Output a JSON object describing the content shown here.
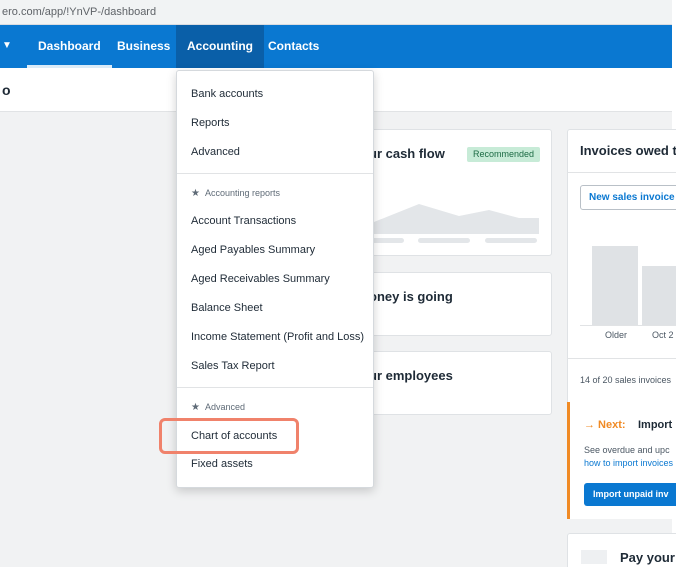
{
  "browser": {
    "url": "ero.com/app/!YnVP-/dashboard"
  },
  "nav": {
    "items": [
      {
        "label": "Dashboard"
      },
      {
        "label": "Business"
      },
      {
        "label": "Accounting"
      },
      {
        "label": "Contacts"
      }
    ],
    "active": "Accounting"
  },
  "org": {
    "name_fragment": "o"
  },
  "cards": {
    "cash_flow": {
      "title": "ur cash flow",
      "badge": "Recommended"
    },
    "money": {
      "title": "oney is going"
    },
    "employees": {
      "title": "ur employees"
    }
  },
  "invoices": {
    "title": "Invoices owed t",
    "new_button": "New sales invoice",
    "chart_labels": [
      "Older",
      "Oct 2"
    ],
    "summary": "14 of 20 sales invoices",
    "next": {
      "label": "→  Next:",
      "title": "Import",
      "description": "See overdue and upc",
      "link": "how to import invoices",
      "button": "Import unpaid inv"
    }
  },
  "pay_card": {
    "title": "Pay your"
  },
  "menu": {
    "top_items": [
      "Bank accounts",
      "Reports",
      "Advanced"
    ],
    "reports_header": "Accounting reports",
    "report_items": [
      "Account Transactions",
      "Aged Payables Summary",
      "Aged Receivables Summary",
      "Balance Sheet",
      "Income Statement (Profit and Loss)",
      "Sales Tax Report"
    ],
    "advanced_header": "Advanced",
    "advanced_items": [
      "Chart of accounts",
      "Fixed assets"
    ],
    "highlighted_item": "Chart of accounts"
  },
  "colors": {
    "nav_blue": "#0a78d1",
    "nav_active": "#0a5fa8",
    "highlight": "#f0826b",
    "next_orange": "#f08a24",
    "badge_bg": "#c7ebd7"
  }
}
